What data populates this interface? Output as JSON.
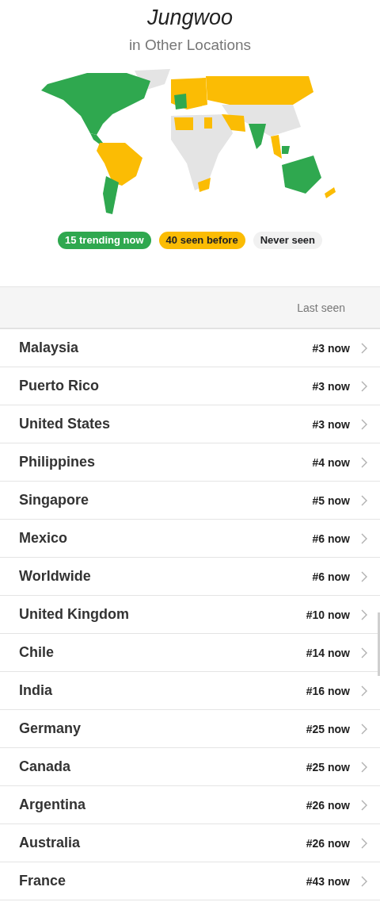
{
  "header": {
    "title": "Jungwoo",
    "subtitle": "in Other Locations"
  },
  "legend": [
    {
      "label": "15 trending now",
      "color": "#2fa84f"
    },
    {
      "label": "40 seen before",
      "color": "#fbbc04"
    },
    {
      "label": "Never seen",
      "color": "#f1f1f1"
    }
  ],
  "table": {
    "columns": [
      "Last seen"
    ],
    "rows": [
      {
        "location": "Malaysia",
        "last_seen": "#3 now"
      },
      {
        "location": "Puerto Rico",
        "last_seen": "#3 now"
      },
      {
        "location": "United States",
        "last_seen": "#3 now"
      },
      {
        "location": "Philippines",
        "last_seen": "#4 now"
      },
      {
        "location": "Singapore",
        "last_seen": "#5 now"
      },
      {
        "location": "Mexico",
        "last_seen": "#6 now"
      },
      {
        "location": "Worldwide",
        "last_seen": "#6 now"
      },
      {
        "location": "United Kingdom",
        "last_seen": "#10 now"
      },
      {
        "location": "Chile",
        "last_seen": "#14 now"
      },
      {
        "location": "India",
        "last_seen": "#16 now"
      },
      {
        "location": "Germany",
        "last_seen": "#25 now"
      },
      {
        "location": "Canada",
        "last_seen": "#25 now"
      },
      {
        "location": "Argentina",
        "last_seen": "#26 now"
      },
      {
        "location": "Australia",
        "last_seen": "#26 now"
      },
      {
        "location": "France",
        "last_seen": "#43 now"
      }
    ]
  }
}
